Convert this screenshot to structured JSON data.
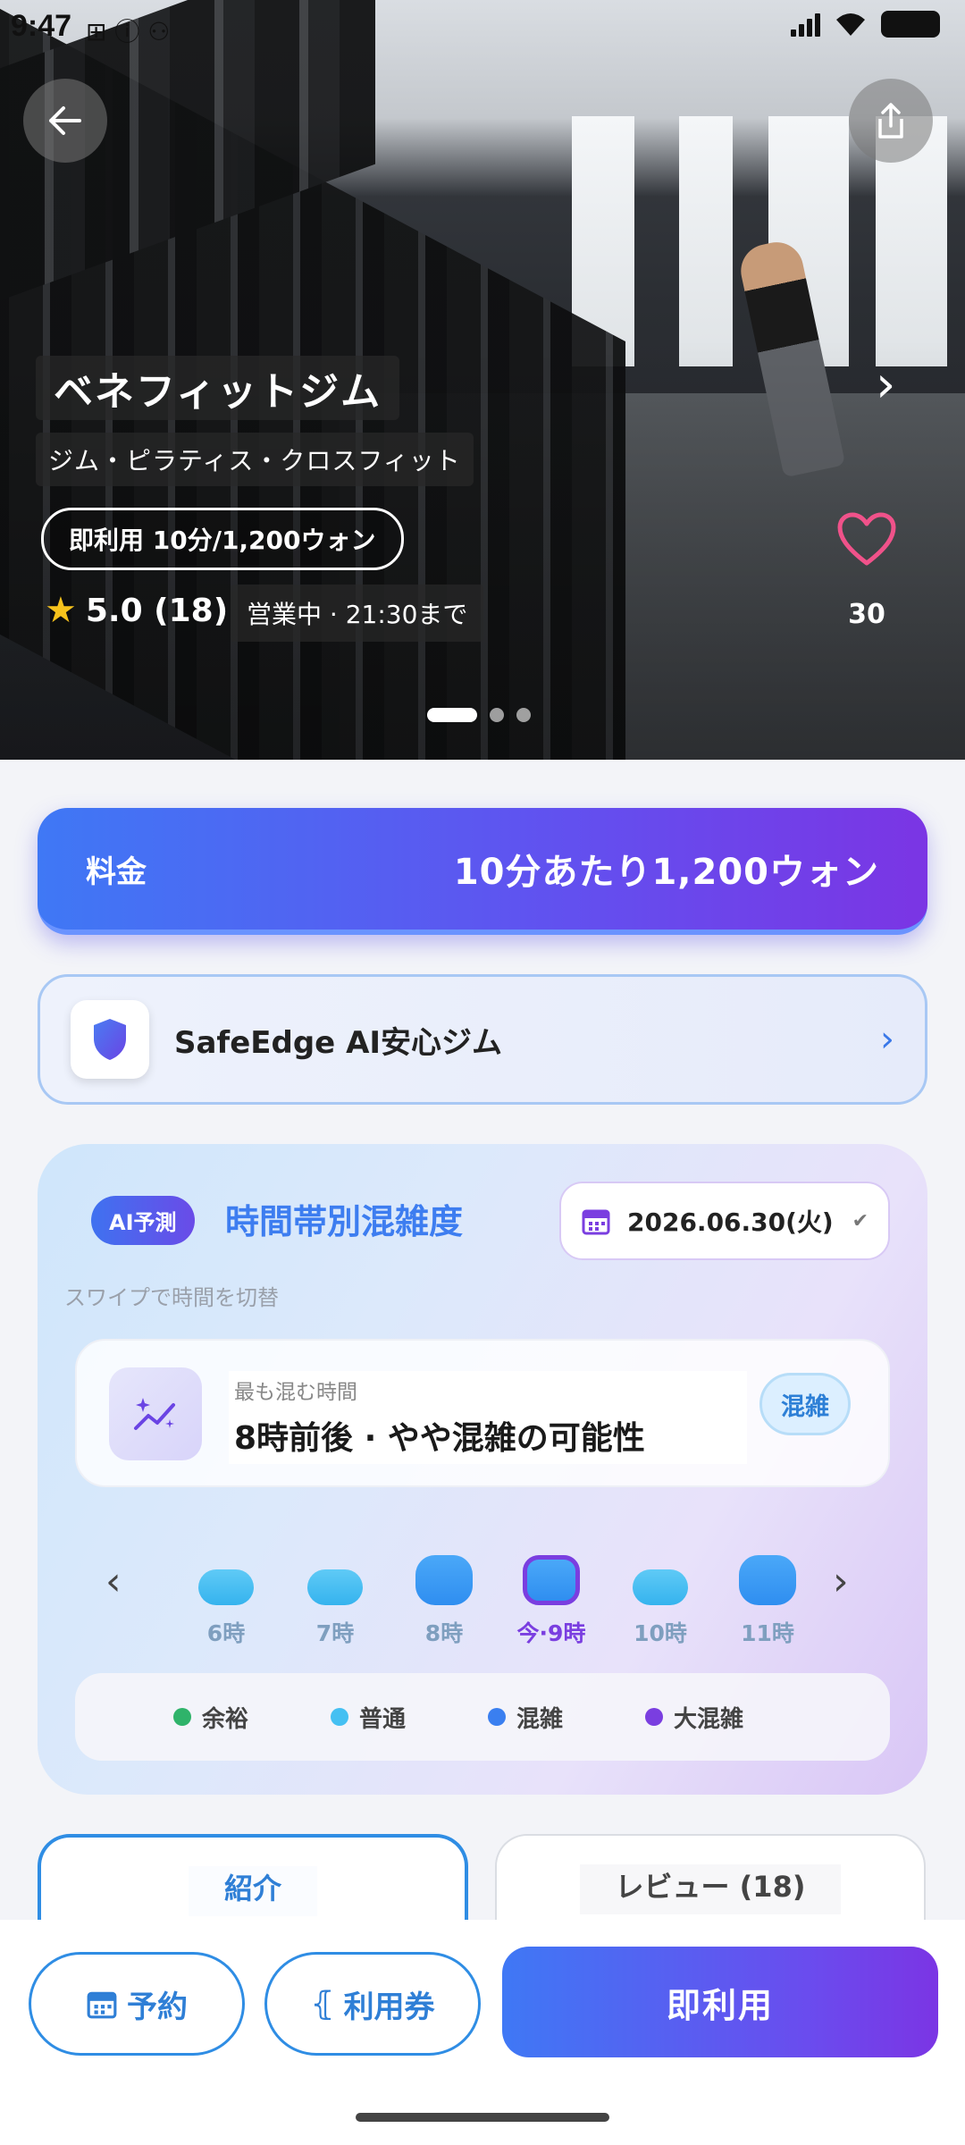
{
  "status_bar": {
    "time": "9:47"
  },
  "hero": {
    "title": "ベネフィットジム",
    "subtitle": "ジム・ピラティス・クロスフィット",
    "price_pill": "即利用 10分/1,200ウォン",
    "rating": "5.0 (18)",
    "open_status": "営業中 · 21:30まで",
    "like_count": "30"
  },
  "price_bar": {
    "label": "料金",
    "value": "10分あたり1,200ウォン"
  },
  "safe_card": {
    "title": "SafeEdge AI安心ジム"
  },
  "congestion": {
    "badge": "AI予測",
    "title": "時間帯別混雑度",
    "date": "2026.06.30(火)",
    "hint": "スワイプで時間を切替",
    "peak_label": "最も混む時間",
    "peak_value": "8時前後 · やや混雑の可能性",
    "peak_badge": "混雑",
    "slots": [
      {
        "label": "6時",
        "level": "普通"
      },
      {
        "label": "7時",
        "level": "普通"
      },
      {
        "label": "8時",
        "level": "混雑"
      },
      {
        "label": "今·9時",
        "level": "混雑"
      },
      {
        "label": "10時",
        "level": "普通"
      },
      {
        "label": "11時",
        "level": "混雑"
      }
    ],
    "legend": [
      {
        "label": "余裕",
        "color": "#2fb36a"
      },
      {
        "label": "普通",
        "color": "#45c0f2"
      },
      {
        "label": "混雑",
        "color": "#3a7ff0"
      },
      {
        "label": "大混雑",
        "color": "#7a3ee0"
      }
    ]
  },
  "tabs": {
    "intro": "紹介",
    "review": "レビュー (18)"
  },
  "bottom_bar": {
    "reserve": "予約",
    "ticket": "利用券",
    "instant": "即利用"
  }
}
